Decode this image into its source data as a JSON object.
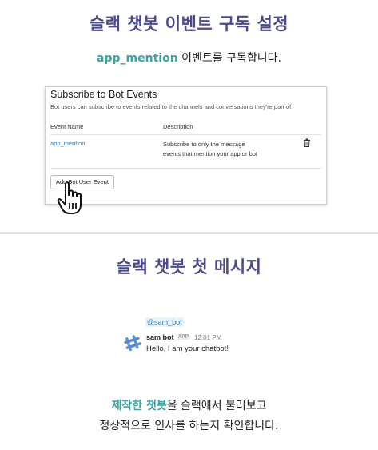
{
  "section1": {
    "title": "슬랙 챗봇 이벤트 구독 설정",
    "subtitle_highlight": "app_mention",
    "subtitle_rest": " 이벤트를 구독합니다.",
    "card": {
      "heading": "Subscribe to Bot Events",
      "description": "Bot users can subscribe to events related to the channels and conversations they're part of.",
      "col_event": "Event Name",
      "col_description": "Description",
      "event_name": "app_mention",
      "event_description": "Subscribe to only the message events that mention your app or bot",
      "add_button": "Add Bot User Event"
    }
  },
  "section2": {
    "title": "슬랙 챗봇 첫 메시지",
    "mention": "@sam_bot",
    "bot_name": "sam bot",
    "app_badge": "APP",
    "time": "12:01 PM",
    "message": "Hello, I am your chatbot!",
    "caption_highlight": "제작한 챗봇",
    "caption_rest1": "을 슬랙에서 불러보고",
    "caption_line2": "정상적으로 인사를 하는지 확인합니다."
  },
  "colors": {
    "title": "#4a4a8a",
    "highlight": "#3aa3a3",
    "link": "#2a7ab8"
  },
  "icons": {
    "trash": "trash-icon",
    "cursor": "hand-pointer-icon",
    "bot_logo": "slack-logo-icon"
  }
}
